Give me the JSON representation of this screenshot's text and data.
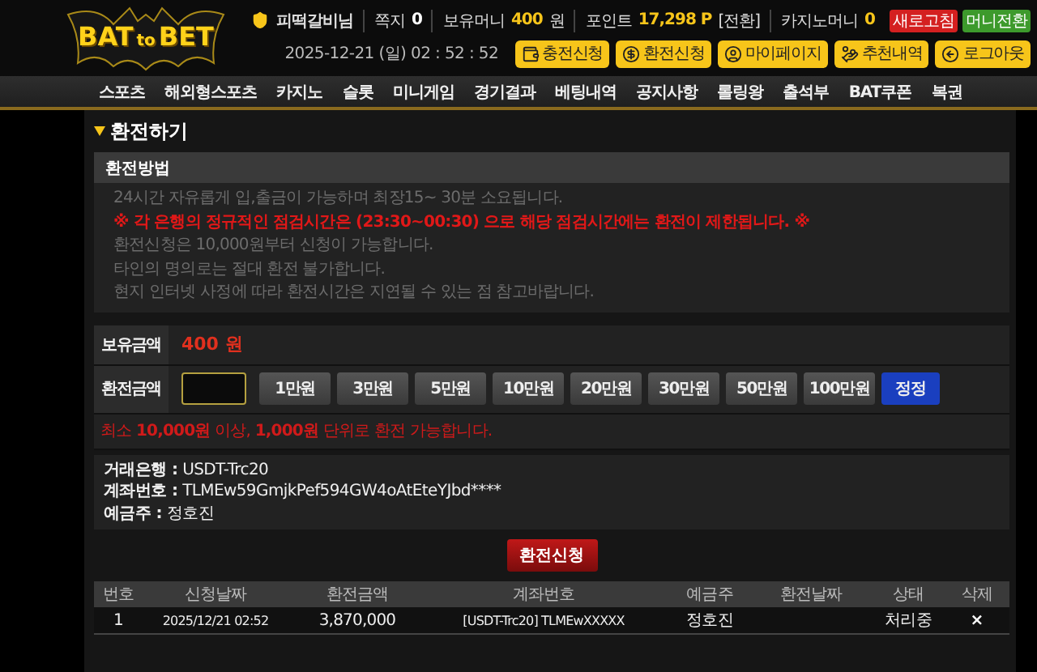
{
  "logo": {
    "parts": [
      "BAT",
      "to",
      "BET"
    ]
  },
  "user_bar": {
    "username": "피떡갈비님",
    "items": [
      {
        "label": "쪽지",
        "value": "0",
        "highlight": false
      },
      {
        "label": "보유머니",
        "value": "400",
        "unit": "원",
        "highlight": true
      },
      {
        "label": "포인트",
        "value": "17,298 P",
        "unit": "[전환]",
        "highlight": true
      },
      {
        "label": "카지노머니",
        "value": "0",
        "highlight": true
      }
    ],
    "badges": [
      {
        "label": "새로고침",
        "color": "#d42020"
      },
      {
        "label": "머니전환",
        "color": "#3d9a2c"
      }
    ]
  },
  "datetime": "2025-12-21 (일) 02 : 52 : 52",
  "header_buttons": [
    "충전신청",
    "환전신청",
    "마이페이지",
    "추천내역",
    "로그아웃"
  ],
  "nav": [
    "스포츠",
    "해외형스포츠",
    "카지노",
    "슬롯",
    "미니게임",
    "경기결과",
    "베팅내역",
    "공지사항",
    "롤링왕",
    "출석부",
    "BAT쿠폰",
    "복권"
  ],
  "page_title": "환전하기",
  "method_panel": {
    "title": "환전방법",
    "notices": [
      {
        "text": "24시간 자유롭게 입,출금이 가능하며 최장15~ 30분 소요됩니다.",
        "kind": "info"
      },
      {
        "text": "※ 각 은행의 정규적인 점검시간은 (23:30~00:30) 으로 해당 점검시간에는 환전이 제한됩니다. ※",
        "kind": "warning"
      },
      {
        "text": "환전신청은 10,000원부터 신청이 가능합니다.",
        "kind": "info"
      },
      {
        "text": "타인의 명의로는 절대 환전 불가합니다.",
        "kind": "info"
      },
      {
        "text": "현지 인터넷 사정에 따라 환전시간은 지연될 수 있는 점 참고바랍니다.",
        "kind": "info"
      }
    ]
  },
  "balance": {
    "label": "보유금액",
    "value": "400 원"
  },
  "amount": {
    "label": "환전금액",
    "quick_buttons": [
      "1만원",
      "3만원",
      "5만원",
      "10만원",
      "20만원",
      "30만원",
      "50만원",
      "100만원"
    ],
    "reset_button": "정정"
  },
  "min_note": "최소 **10,000원** 이상, **1,000원** 단위로 환전 가능합니다.",
  "account": [
    "**거래은행 :** USDT-Trc20",
    "**계좌번호 :** TLMEw59GmjkPef594GW4oAtEteYJbd****",
    "**예금주 :** 정호진"
  ],
  "submit_button": "환전신청",
  "table": {
    "columns": [
      "번호",
      "신청날짜",
      "환전금액",
      "계좌번호",
      "예금주",
      "환전날짜",
      "상태",
      "삭제"
    ],
    "rows": [
      {
        "no": "1",
        "date": "2025/12/21 02:52",
        "amount": "3,870,000",
        "account": "[USDT-Trc20] TLMEwXXXXX",
        "holder": "정호진",
        "status": "처리중",
        "delete": "×"
      }
    ]
  }
}
